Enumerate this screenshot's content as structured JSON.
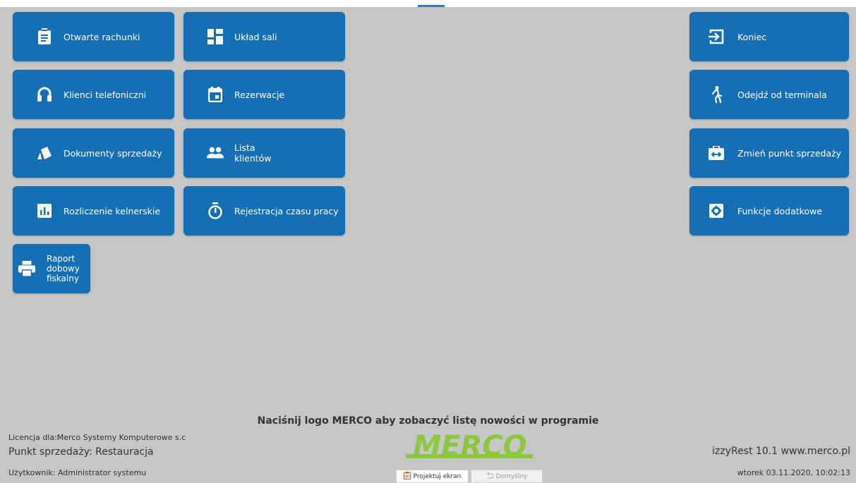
{
  "tiles_left": [
    {
      "label": "Otwarte rachunki",
      "icon": "clipboard-icon"
    },
    {
      "label": "Układ sali",
      "icon": "dashboard-layout-icon"
    },
    {
      "label": "Klienci telefoniczni",
      "icon": "headset-icon"
    },
    {
      "label": "Rezerwacje",
      "icon": "calendar-icon"
    },
    {
      "label": "Dokumenty sprzedaży",
      "icon": "documents-icon"
    },
    {
      "label": "Lista\nklientów",
      "icon": "people-icon"
    },
    {
      "label": "Rozliczenie kelnerskie",
      "icon": "bar-chart-icon"
    },
    {
      "label": "Rejestracja czasu pracy",
      "icon": "stopwatch-icon"
    },
    {
      "label": "Raport\ndobowy\nfiskalny",
      "icon": "printer-icon"
    }
  ],
  "tiles_right": [
    {
      "label": "Koniec",
      "icon": "exit-icon"
    },
    {
      "label": "Odejdź od terminala",
      "icon": "walking-person-icon"
    },
    {
      "label": "Zmień punkt sprzedaży",
      "icon": "swap-point-icon"
    },
    {
      "label": "Funkcje dodatkowe",
      "icon": "settings-icon"
    }
  ],
  "footer": {
    "hint": "Naciśnij logo MERCO aby zobaczyć listę nowości w programie",
    "license": "Licencja dla:Merco Systemy Komputerowe s.c",
    "point_of_sale": "Punkt sprzedaży: Restauracja",
    "user": "Użytkownik: Administrator systemu",
    "version": "izzyRest 10.1 www.merco.pl",
    "datetime": "wtorek 03.11.2020, 10:02:13",
    "logo_text": "MERCO",
    "design_button": "Projektuj ekran",
    "default_button": "Domyślny"
  },
  "colors": {
    "tile": "#156fb2",
    "background": "#c6c6c6",
    "logo": "#8dc63f"
  }
}
